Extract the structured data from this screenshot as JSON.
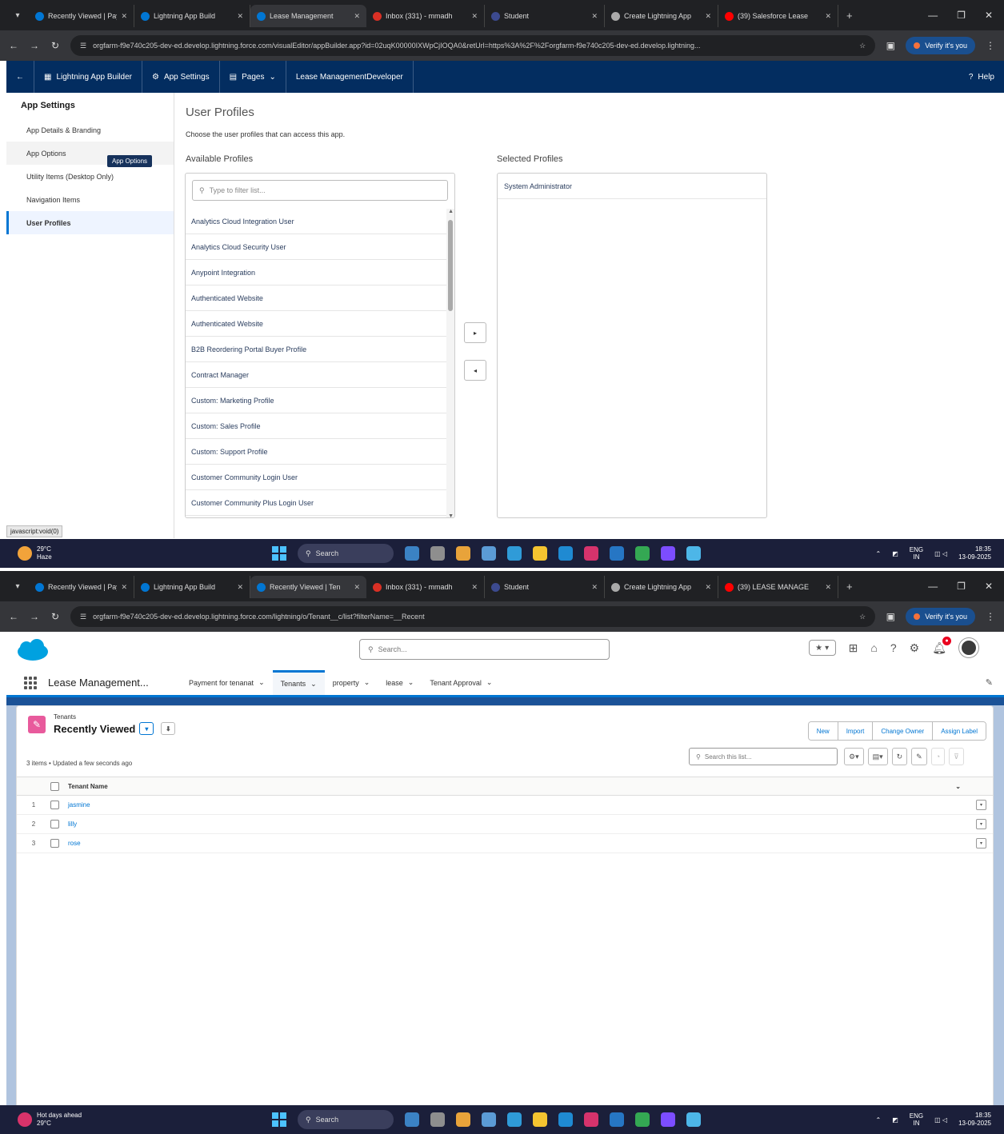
{
  "screen1": {
    "browser": {
      "tabs": [
        {
          "title": "Recently Viewed | Pay",
          "color": "#0176d3"
        },
        {
          "title": "Lightning App Build",
          "color": "#0176d3"
        },
        {
          "title": "Lease Management",
          "color": "#0176d3",
          "active": true
        },
        {
          "title": "Inbox (331) - mmadh",
          "color": "#d93025"
        },
        {
          "title": "Student",
          "color": "#3c4a8f"
        },
        {
          "title": "Create Lightning App",
          "color": "#aaaaaa"
        },
        {
          "title": "(39) Salesforce Lease",
          "color": "#ff0000"
        }
      ],
      "url": "orgfarm-f9e740c205-dev-ed.develop.lightning.force.com/visualEditor/appBuilder.app?id=02uqK00000IXWpCjIOQA0&retUrl=https%3A%2F%2Forgfarm-f9e740c205-dev-ed.develop.lightning...",
      "verify_label": "Verify it's you"
    },
    "header": {
      "builder_label": "Lightning App Builder",
      "app_settings_label": "App Settings",
      "pages_label": "Pages",
      "app_name": "Lease ManagementDeveloper",
      "help_label": "Help"
    },
    "sidebar": {
      "heading": "App Settings",
      "items": [
        {
          "label": "App Details & Branding"
        },
        {
          "label": "App Options"
        },
        {
          "label": "Utility Items (Desktop Only)"
        },
        {
          "label": "Navigation Items"
        },
        {
          "label": "User Profiles"
        }
      ],
      "tooltip": "App Options",
      "status_link": "javascript:void(0)"
    },
    "main": {
      "title": "User Profiles",
      "description": "Choose the user profiles that can access this app.",
      "available_heading": "Available Profiles",
      "selected_heading": "Selected Profiles",
      "filter_placeholder": "Type to filter list...",
      "available": [
        "Analytics Cloud Integration User",
        "Analytics Cloud Security User",
        "Anypoint Integration",
        "Authenticated Website",
        "Authenticated Website",
        "B2B Reordering Portal Buyer Profile",
        "Contract Manager",
        "Custom: Marketing Profile",
        "Custom: Sales Profile",
        "Custom: Support Profile",
        "Customer Community Login User",
        "Customer Community Plus Login User"
      ],
      "selected": [
        "System Administrator"
      ]
    },
    "taskbar": {
      "temp": "29°C",
      "weather": "Haze",
      "search": "Search",
      "lang": "ENG",
      "lang2": "IN",
      "time": "18:35",
      "date": "13-09-2025"
    }
  },
  "screen2": {
    "browser": {
      "tabs": [
        {
          "title": "Recently Viewed | Pay",
          "color": "#0176d3"
        },
        {
          "title": "Lightning App Build",
          "color": "#0176d3"
        },
        {
          "title": "Recently Viewed | Ten",
          "color": "#0176d3",
          "active": true
        },
        {
          "title": "Inbox (331) - mmadh",
          "color": "#d93025"
        },
        {
          "title": "Student",
          "color": "#3c4a8f"
        },
        {
          "title": "Create Lightning App",
          "color": "#aaaaaa"
        },
        {
          "title": "(39) LEASE MANAGE",
          "color": "#ff0000"
        }
      ],
      "url": "orgfarm-f9e740c205-dev-ed.develop.lightning.force.com/lightning/o/Tenant__c/list?filterName=__Recent",
      "verify_label": "Verify it's you"
    },
    "global_search_placeholder": "Search...",
    "app_name": "Lease Management...",
    "nav_tabs": [
      {
        "label": "Payment for tenanat"
      },
      {
        "label": "Tenants",
        "active": true
      },
      {
        "label": "property"
      },
      {
        "label": "lease"
      },
      {
        "label": "Tenant Approval"
      }
    ],
    "list_view": {
      "object": "Tenants",
      "title": "Recently Viewed",
      "meta": "3 items • Updated a few seconds ago",
      "actions": [
        "New",
        "Import",
        "Change Owner",
        "Assign Label"
      ],
      "search_placeholder": "Search this list...",
      "column": "Tenant Name",
      "rows": [
        {
          "num": "1",
          "name": "jasmine"
        },
        {
          "num": "2",
          "name": "lilly"
        },
        {
          "num": "3",
          "name": "rose"
        }
      ]
    },
    "taskbar": {
      "weather_line1": "Hot days ahead",
      "weather_line2": "29°C",
      "search": "Search",
      "lang": "ENG",
      "lang2": "IN",
      "time": "18:35",
      "date": "13-09-2025"
    }
  }
}
